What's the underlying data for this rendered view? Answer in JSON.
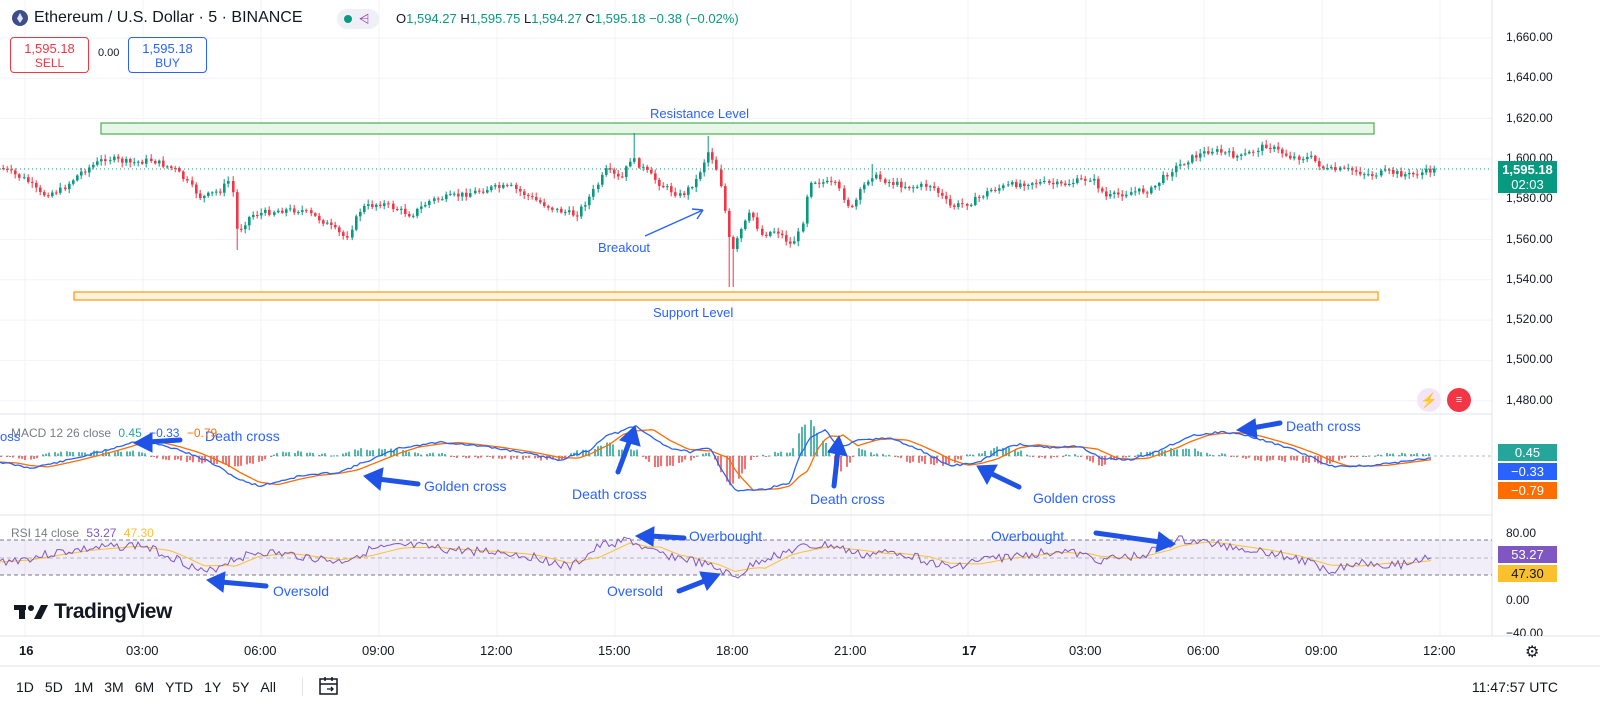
{
  "header": {
    "symbol_title": "Ethereum / U.S. Dollar · 5 · BINANCE",
    "ohlc": {
      "o_label": "O",
      "o": "1,594.27",
      "h_label": "H",
      "h": "1,595.75",
      "l_label": "L",
      "l": "1,594.27",
      "c_label": "C",
      "c": "1,595.18",
      "change": "−0.38 (−0.02%)"
    },
    "sell_price": "1,595.18",
    "sell_label": "SELL",
    "buy_price": "1,595.18",
    "buy_label": "BUY",
    "spread": "0.00"
  },
  "price_axis": {
    "ticks": [
      "1,660.00",
      "1,640.00",
      "1,620.00",
      "1,600.00",
      "1,580.00",
      "1,560.00",
      "1,540.00",
      "1,520.00",
      "1,500.00",
      "1,480.00"
    ],
    "last_price": "1,595.18",
    "countdown": "02:03",
    "last_color": "#089981"
  },
  "time_axis": {
    "ticks": [
      "16",
      "03:00",
      "06:00",
      "09:00",
      "12:00",
      "15:00",
      "18:00",
      "21:00",
      "17",
      "03:00",
      "06:00",
      "09:00",
      "12:00"
    ]
  },
  "annotations": {
    "resistance": "Resistance Level",
    "support": "Support Level",
    "breakout": "Breakout",
    "golden_cross_1": "Golden cross",
    "golden_cross_2": "Golden cross",
    "death_cross_1": "Death cross",
    "death_cross_2": "Death cross",
    "death_cross_3": "Death cross",
    "death_cross_4": "Death cross",
    "death_cross_clip": "oss",
    "overbought_1": "Overbought",
    "overbought_2": "Overbought",
    "oversold_1": "Oversold",
    "oversold_2": "Oversold"
  },
  "macd": {
    "label": "MACD 12 26 close",
    "v1": "0.45",
    "v2": "−0.33",
    "v3": "−0.79",
    "colors": {
      "hist_up": "#26a69a",
      "hist_down": "#ef5350",
      "macd": "#2962ff",
      "signal": "#ff6d00"
    }
  },
  "rsi": {
    "label": "RSI 14 close",
    "v1": "53.27",
    "v2": "47.30",
    "ticks": [
      "80.00",
      "0.00",
      "−40.00"
    ],
    "colors": {
      "rsi": "#7e57c2",
      "ma": "#fbc02d"
    }
  },
  "brand": "TradingView",
  "timeframes": [
    "1D",
    "5D",
    "1M",
    "3M",
    "6M",
    "YTD",
    "1Y",
    "5Y",
    "All"
  ],
  "clock": "11:47:57 UTC",
  "colors": {
    "up": "#089981",
    "down": "#f23645",
    "accent": "#2962ff"
  }
}
